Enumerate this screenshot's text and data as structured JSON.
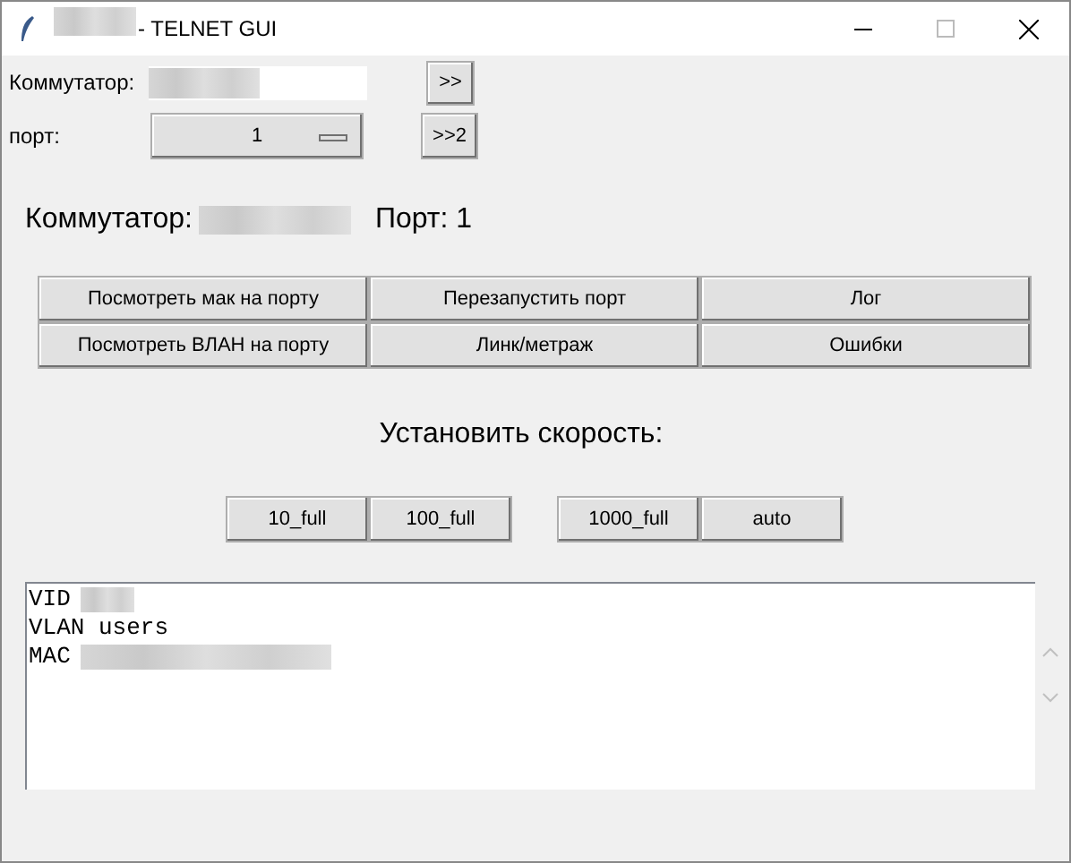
{
  "window": {
    "title": "- TELNET GUI"
  },
  "switch_field": {
    "label": "Коммутатор:"
  },
  "go_button": ">>",
  "port_field": {
    "label": "порт:",
    "value": "1"
  },
  "go2_button": ">>2",
  "status": {
    "switch_label": "Коммутатор:",
    "port_text": "Порт: 1"
  },
  "actions": [
    "Посмотреть мак на порту",
    "Перезапустить порт",
    "Лог",
    "Посмотреть ВЛАН на порту",
    "Линк/метраж",
    "Ошибки"
  ],
  "speed_title": "Установить скорость:",
  "speed_buttons": [
    "10_full",
    "100_full",
    "1000_full",
    "auto"
  ],
  "output_lines": [
    "VID",
    "VLAN users",
    "MAC"
  ]
}
